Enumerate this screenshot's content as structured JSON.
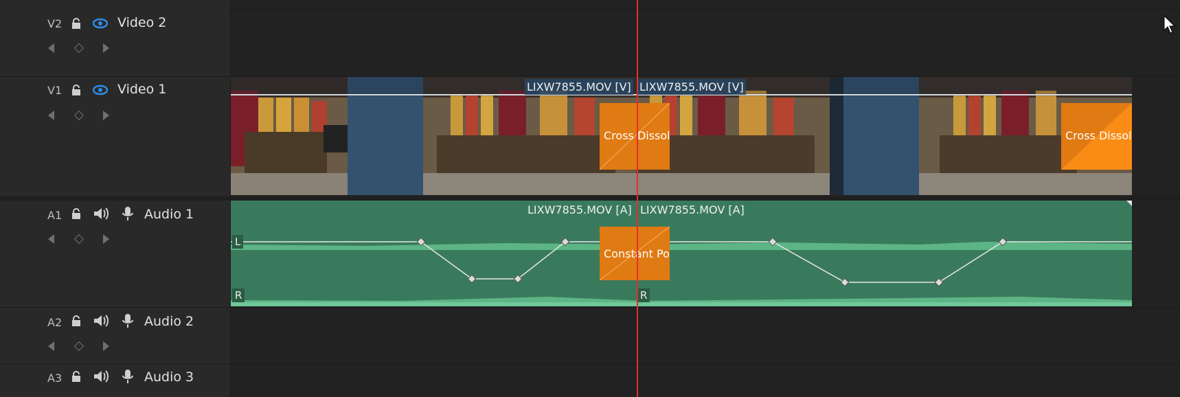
{
  "tracks": {
    "v2": {
      "code": "V2",
      "name": "Video 2"
    },
    "v1": {
      "code": "V1",
      "name": "Video 1"
    },
    "a1": {
      "code": "A1",
      "name": "Audio 1"
    },
    "a2": {
      "code": "A2",
      "name": "Audio 2"
    },
    "a3": {
      "code": "A3",
      "name": "Audio 3"
    }
  },
  "video_clips": {
    "left_name": "LIXW7855.MOV [V]",
    "right_name": "LIXW7855.MOV [V]",
    "transition_1": "Cross Dissolve",
    "transition_2": "Cross Dissolve"
  },
  "audio_clips": {
    "left_name": "LIXW7855.MOV [A]",
    "right_name": "LIXW7855.MOV [A]",
    "transition": "Constant Power",
    "left_channel": "L",
    "right_channel_1": "R",
    "right_channel_2": "R"
  },
  "colors": {
    "accent_eye": "#2d8ceb",
    "playhead": "#e03030",
    "transition": "#e07a12",
    "audio_clip": "#3a7a5c",
    "video_gap": "#33526f"
  }
}
